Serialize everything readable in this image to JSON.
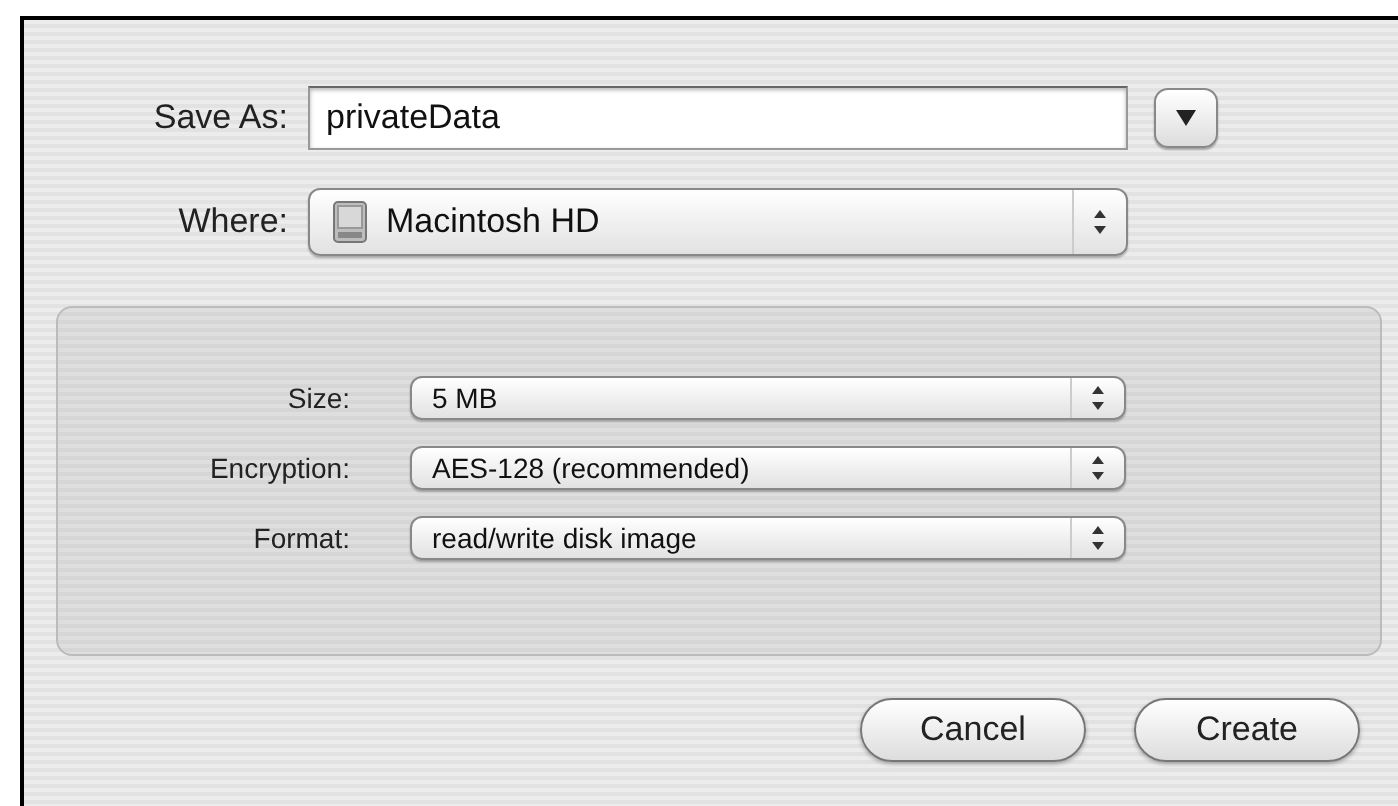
{
  "save_as": {
    "label": "Save As:",
    "value": "privateData"
  },
  "where": {
    "label": "Where:",
    "value": "Macintosh HD"
  },
  "options": [
    {
      "label": "Size:",
      "value": "5 MB"
    },
    {
      "label": "Encryption:",
      "value": "AES-128 (recommended)"
    },
    {
      "label": "Format:",
      "value": "read/write disk image"
    }
  ],
  "buttons": [
    "Cancel",
    "Create"
  ]
}
